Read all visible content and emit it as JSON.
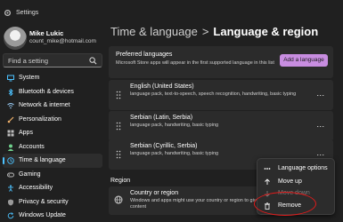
{
  "window": {
    "app_title": "Settings"
  },
  "user": {
    "name": "Mike Lukic",
    "email": "count_mike@hotmail.com"
  },
  "search": {
    "placeholder": "Find a setting"
  },
  "nav": [
    {
      "label": "System",
      "icon": "monitor-icon",
      "color": "#4cc2ff"
    },
    {
      "label": "Bluetooth & devices",
      "icon": "bluetooth-icon",
      "color": "#4cc2ff"
    },
    {
      "label": "Network & internet",
      "icon": "wifi-icon",
      "color": "#9fd4ff"
    },
    {
      "label": "Personalization",
      "icon": "brush-icon",
      "color": "#f2b36b"
    },
    {
      "label": "Apps",
      "icon": "apps-icon",
      "color": "#bdbdbd"
    },
    {
      "label": "Accounts",
      "icon": "person-icon",
      "color": "#6fd08c"
    },
    {
      "label": "Time & language",
      "icon": "clock-globe-icon",
      "color": "#4cc2ff",
      "active": true
    },
    {
      "label": "Gaming",
      "icon": "controller-icon",
      "color": "#bdbdbd"
    },
    {
      "label": "Accessibility",
      "icon": "accessibility-icon",
      "color": "#4cc2ff"
    },
    {
      "label": "Privacy & security",
      "icon": "shield-icon",
      "color": "#9a9a9a"
    },
    {
      "label": "Windows Update",
      "icon": "refresh-icon",
      "color": "#4cc2ff"
    }
  ],
  "breadcrumb": {
    "parent": "Time & language",
    "separator": ">",
    "current": "Language & region"
  },
  "preferred": {
    "title": "Preferred languages",
    "description": "Microsoft Store apps will appear in the first supported language in this list",
    "add_button": "Add a language"
  },
  "languages": [
    {
      "name": "English (United States)",
      "features": "language pack, text-to-speech, speech recognition, handwriting, basic typing"
    },
    {
      "name": "Serbian (Latin, Serbia)",
      "features": "language pack, handwriting, basic typing"
    },
    {
      "name": "Serbian (Cyrillic, Serbia)",
      "features": "language pack, handwriting, basic typing"
    }
  ],
  "more_label": "...",
  "region": {
    "heading": "Region",
    "title": "Country or region",
    "description": "Windows and apps might use your country or region to give you local content"
  },
  "context_menu": {
    "items": [
      {
        "label": "Language options",
        "icon": "options-icon",
        "disabled": false
      },
      {
        "label": "Move up",
        "icon": "arrow-up-icon",
        "disabled": false
      },
      {
        "label": "Move down",
        "icon": "arrow-down-icon",
        "disabled": true
      },
      {
        "label": "Remove",
        "icon": "trash-icon",
        "disabled": false
      }
    ]
  },
  "colors": {
    "accent": "#4cc2ff",
    "add_button": "#c88de0",
    "highlight": "#e01b1b"
  }
}
